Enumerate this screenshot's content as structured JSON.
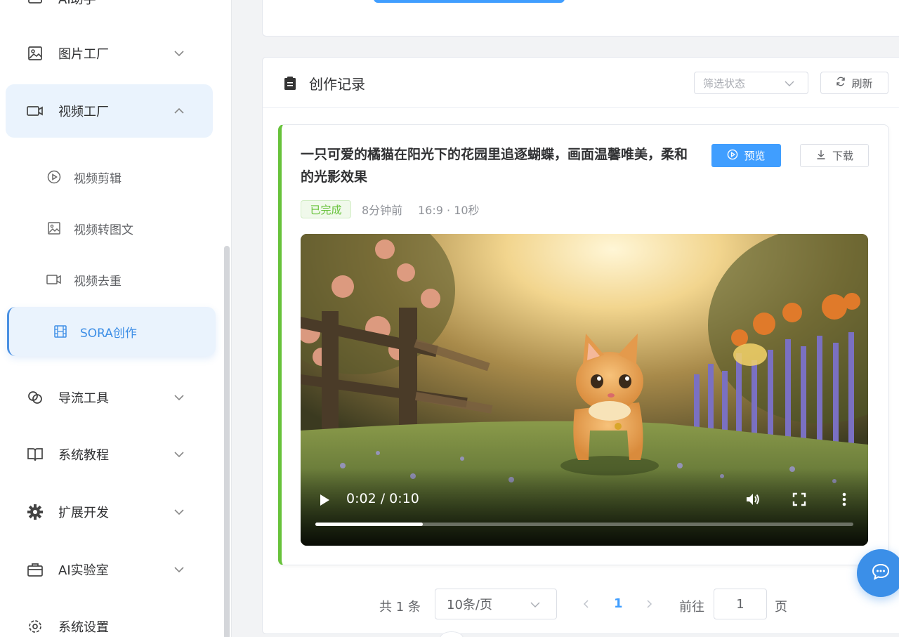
{
  "sidebar": {
    "top_partial_label": "AI助手",
    "menu": [
      {
        "label": "图片工厂",
        "icon": "image-icon",
        "expanded": false
      },
      {
        "label": "视频工厂",
        "icon": "video-camera-icon",
        "expanded": true
      },
      {
        "label": "导流工具",
        "icon": "link-icon",
        "expanded": false
      },
      {
        "label": "系统教程",
        "icon": "book-icon",
        "expanded": false
      },
      {
        "label": "扩展开发",
        "icon": "gear-icon",
        "expanded": false
      },
      {
        "label": "AI实验室",
        "icon": "briefcase-icon",
        "expanded": false
      },
      {
        "label": "系统设置",
        "icon": "settings-icon",
        "expanded": false
      }
    ],
    "video_submenu": [
      {
        "label": "视频剪辑",
        "icon": "play-circle-icon"
      },
      {
        "label": "视频转图文",
        "icon": "image-icon"
      },
      {
        "label": "视频去重",
        "icon": "video-camera-icon"
      },
      {
        "label": "SORA创作",
        "icon": "film-icon",
        "active": true
      }
    ]
  },
  "records": {
    "title": "创作记录",
    "filter_placeholder": "筛选状态",
    "refresh_label": "刷新"
  },
  "item": {
    "prompt": "一只可爱的橘猫在阳光下的花园里追逐蝴蝶，画面温馨唯美，柔和的光影效果",
    "preview_label": "预览",
    "download_label": "下载",
    "status": "已完成",
    "time_ago": "8分钟前",
    "spec": "16:9 · 10秒",
    "video": {
      "current_time": "0:02",
      "separator": "/",
      "duration": "0:10",
      "progress": 0.2
    }
  },
  "pagination": {
    "total": "共 1 条",
    "page_size": "10条/页",
    "current_page": "1",
    "goto_label": "前往",
    "goto_value": "1",
    "page_unit": "页"
  },
  "colors": {
    "accent": "#409eff",
    "success": "#67c23a",
    "sidebar_active_bg": "#eaf3fd"
  }
}
